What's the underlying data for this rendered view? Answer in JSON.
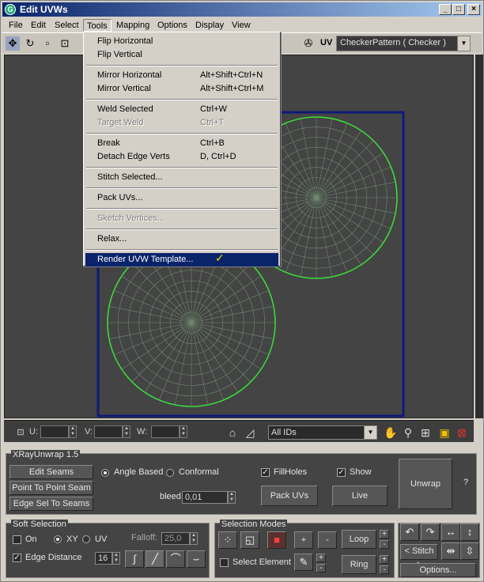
{
  "window": {
    "title": "Edit UVWs",
    "app_icon": "3ds-max-icon",
    "min": "_",
    "max": "□",
    "close": "×"
  },
  "menubar": {
    "items": [
      "File",
      "Edit",
      "Select",
      "Tools",
      "Mapping",
      "Options",
      "Display",
      "View"
    ]
  },
  "toolbar": {
    "uv_label": "UV",
    "texture": "CheckerPattern  ( Checker )"
  },
  "tools_menu": {
    "items": [
      {
        "label": "Flip Horizontal",
        "shortcut": ""
      },
      {
        "label": "Flip Vertical",
        "shortcut": ""
      },
      {
        "label": "Mirror Horizontal",
        "shortcut": "Alt+Shift+Ctrl+N"
      },
      {
        "label": "Mirror Vertical",
        "shortcut": "Alt+Shift+Ctrl+M"
      },
      {
        "label": "Weld Selected",
        "shortcut": "Ctrl+W"
      },
      {
        "label": "Target Weld",
        "shortcut": "Ctrl+T"
      },
      {
        "label": "Break",
        "shortcut": "Ctrl+B"
      },
      {
        "label": "Detach Edge Verts",
        "shortcut": "D, Ctrl+D"
      },
      {
        "label": "Stitch Selected...",
        "shortcut": ""
      },
      {
        "label": "Pack UVs...",
        "shortcut": ""
      },
      {
        "label": "Sketch Vertices...",
        "shortcut": ""
      },
      {
        "label": "Relax...",
        "shortcut": ""
      },
      {
        "label": "Render UVW Template...",
        "shortcut": ""
      }
    ]
  },
  "viewport_bar": {
    "u_label": "U:",
    "v_label": "V:",
    "w_label": "W:",
    "ids": "All IDs"
  },
  "xray": {
    "title": "XRayUnwrap 1.5",
    "edit_seams": "Edit Seams",
    "point_to_point": "Point To Point Seam",
    "edge_sel_to_seams": "Edge Sel To Seams",
    "angle_based": "Angle Based",
    "conformal": "Conformal",
    "fill_holes": "FillHoles",
    "show": "Show",
    "unwrap": "Unwrap",
    "help": "?",
    "bleed_label": "bleed",
    "bleed_value": "0,01",
    "pack_uvs": "Pack UVs",
    "live": "Live"
  },
  "soft_selection": {
    "title": "Soft Selection",
    "on": "On",
    "xy": "XY",
    "uv": "UV",
    "falloff_label": "Falloff:",
    "falloff_value": "25,0",
    "edge_distance": "Edge Distance",
    "edge_distance_value": "16"
  },
  "selection_modes": {
    "title": "Selection Modes",
    "plus": "+",
    "minus": "-",
    "loop": "Loop",
    "ring": "Ring",
    "select_element": "Select Element"
  },
  "stitch": {
    "label": "< Stitch >",
    "options": "Options..."
  },
  "colors": {
    "uv_wire": "#39e03a",
    "uv_border": "#0e1a7a",
    "viewport_bg": "#444444",
    "menu_highlight": "#0a246a"
  }
}
